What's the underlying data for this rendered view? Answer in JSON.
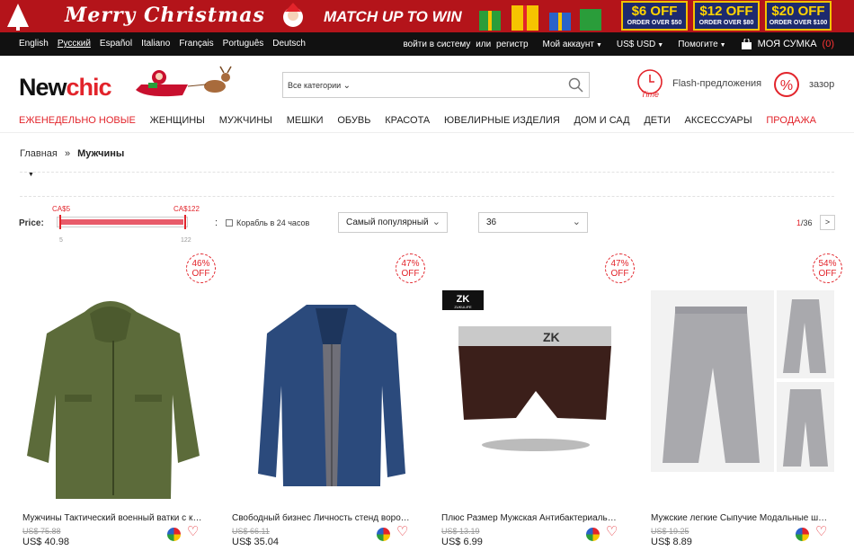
{
  "banner": {
    "headline": "Merry Christmas",
    "tagline": "MATCH UP TO WIN",
    "coupons": [
      {
        "amount": "$6 OFF",
        "condition": "ORDER OVER $50"
      },
      {
        "amount": "$12 OFF",
        "condition": "ORDER OVER $80"
      },
      {
        "amount": "$20 OFF",
        "condition": "ORDER OVER $100"
      }
    ]
  },
  "topbar": {
    "languages": [
      "English",
      "Русский",
      "Español",
      "Italiano",
      "Français",
      "Português",
      "Deutsch"
    ],
    "login": "войти в систему",
    "or": "или",
    "register": "регистр",
    "account": "Мой аккаунт",
    "currency": "US$ USD",
    "help": "Помогите",
    "cart_label": "МОЯ СУМКА",
    "cart_count": "(0)"
  },
  "header": {
    "logo_left": "New",
    "logo_right": "chic",
    "search_category": "Все категории",
    "flash": "Flash-предложения",
    "sale": "зазор",
    "time_icon_text": "Time"
  },
  "nav": [
    "ЕЖЕНЕДЕЛЬНО НОВЫЕ",
    "ЖЕНЩИНЫ",
    "МУЖЧИНЫ",
    "МЕШКИ",
    "ОБУВЬ",
    "КРАСОТА",
    "ЮВЕЛИРНЫЕ ИЗДЕЛИЯ",
    "ДОМ И САД",
    "ДЕТИ",
    "АКСЕССУАРЫ",
    "ПРОДАЖА"
  ],
  "breadcrumb": {
    "home": "Главная",
    "sep": "»",
    "current": "Мужчины"
  },
  "filters": {
    "price_label": "Price:",
    "min_label": "CA$5",
    "max_label": "CA$122",
    "min_tick": "5",
    "max_tick": "122",
    "range_fill": 0.98,
    "colon": ":",
    "ship24": "Корабль в 24 часов",
    "sort": "Самый популярный",
    "per_page": "36",
    "page_current": "1",
    "page_total": "/36",
    "next": ">"
  },
  "products": [
    {
      "name": "Мужчины Тактический военный ватки с капю...",
      "old": "US$ 75.88",
      "price": "US$ 40.98",
      "discount": "46",
      "off_pct": "%",
      "off": "OFF"
    },
    {
      "name": "Свободный бизнес Личность стенд воротник...",
      "old": "US$ 66.11",
      "price": "US$ 35.04",
      "discount": "47",
      "off_pct": "%",
      "off": "OFF"
    },
    {
      "name": "Плюс Размер Мужская Антибактериальная д...",
      "old": "US$ 13.19",
      "price": "US$ 6.99",
      "discount": "47",
      "off_pct": "%",
      "off": "OFF",
      "brand": "ZK",
      "brand_sub": "ZUKULIFE",
      "waistband": "ZK"
    },
    {
      "name": "Мужские легкие Сыпучие Модальные штаны ...",
      "old": "US$ 19.25",
      "price": "US$ 8.89",
      "discount": "54",
      "off_pct": "%",
      "off": "OFF"
    }
  ]
}
